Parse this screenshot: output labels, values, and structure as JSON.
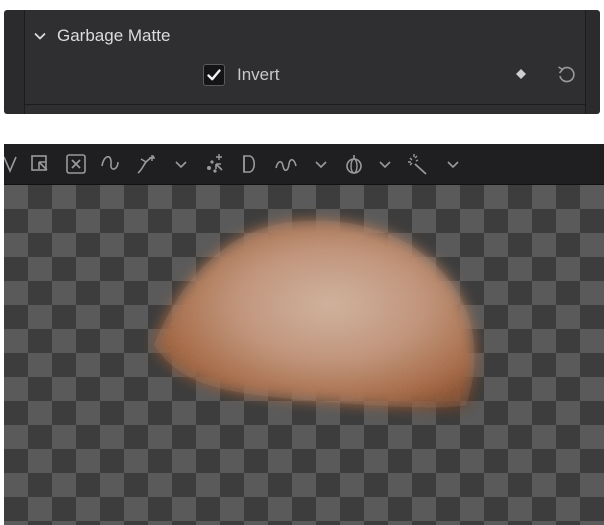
{
  "inspector": {
    "section_title": "Garbage Matte",
    "invert": {
      "label": "Invert",
      "checked": true
    }
  },
  "viewer": {
    "toolbar_icons": [
      "polyline-tool-icon",
      "select-rect-icon",
      "delete-points-icon",
      "smooth-curve-icon",
      "bezier-curve-icon",
      "bezier-dropdown-icon",
      "add-points-icon",
      "bspline-icon",
      "wave-icon",
      "wave-dropdown-icon",
      "onion-skin-icon",
      "onion-dropdown-icon",
      "magic-wand-icon",
      "magic-dropdown-icon"
    ]
  },
  "colors": {
    "panel_bg": "#2f2f32",
    "text": "#dcdcdc",
    "toolbar_bg": "#1f1f21",
    "checker_dark": "#3d3d3d",
    "checker_light": "#5a5a5a",
    "matte_color": "#b07a55"
  }
}
